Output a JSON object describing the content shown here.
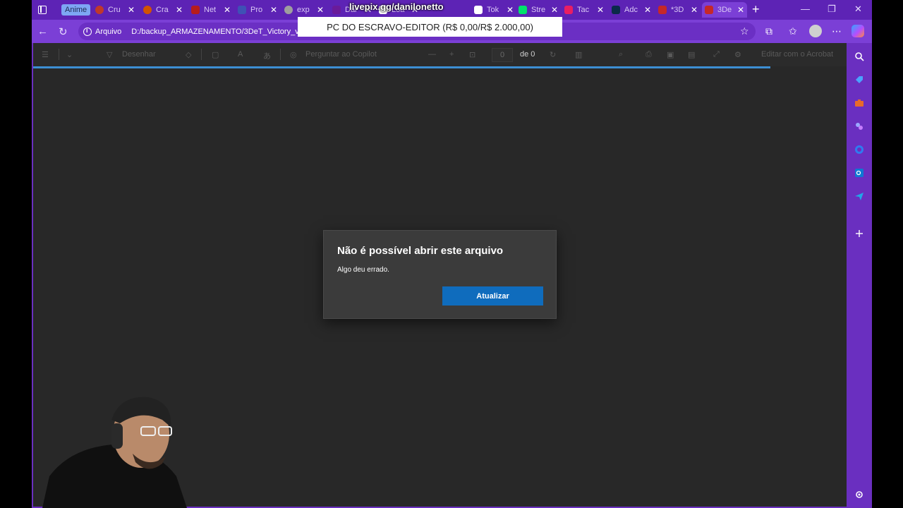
{
  "overlay": {
    "livepix": "livepix.gg/danilonetto",
    "goal": "PC DO ESCRAVO-EDITOR (R$ 0,00/R$ 2.000,00)"
  },
  "tabs": {
    "group_label": "Anime",
    "items": [
      {
        "title": "Cru",
        "color": "#c0392b"
      },
      {
        "title": "Cra",
        "color": "#d35400"
      },
      {
        "title": "Net",
        "color": "#b71c1c"
      },
      {
        "title": "Pro",
        "color": "#3f51b5"
      },
      {
        "title": "exp",
        "color": "#9e9e9e"
      },
      {
        "title": "Dar",
        "color": "#6a1b9a"
      },
      {
        "title": "Loa",
        "color": "#ffffff"
      },
      {
        "title": "Tok",
        "color": "#ffffff"
      },
      {
        "title": "Stre",
        "color": "#00e26b"
      },
      {
        "title": "Tac",
        "color": "#e91e63"
      },
      {
        "title": "Adc",
        "color": "#0b2a4a"
      },
      {
        "title": "*3D",
        "color": "#c62828"
      },
      {
        "title": "3De",
        "color": "#c62828"
      }
    ]
  },
  "address_bar": {
    "scheme_label": "Arquivo",
    "url": "D:/backup_ARMAZENAMENTO/3DeT_Victory_v2"
  },
  "pdf_toolbar": {
    "draw_label": "Desenhar",
    "copilot_label": "Perguntar ao Copilot",
    "page_current": "0",
    "page_total": "de 0",
    "acrobat_label": "Editar com o Acrobat"
  },
  "dialog": {
    "title": "Não é possível abrir este arquivo",
    "message": "Algo deu errado.",
    "button": "Atualizar"
  }
}
